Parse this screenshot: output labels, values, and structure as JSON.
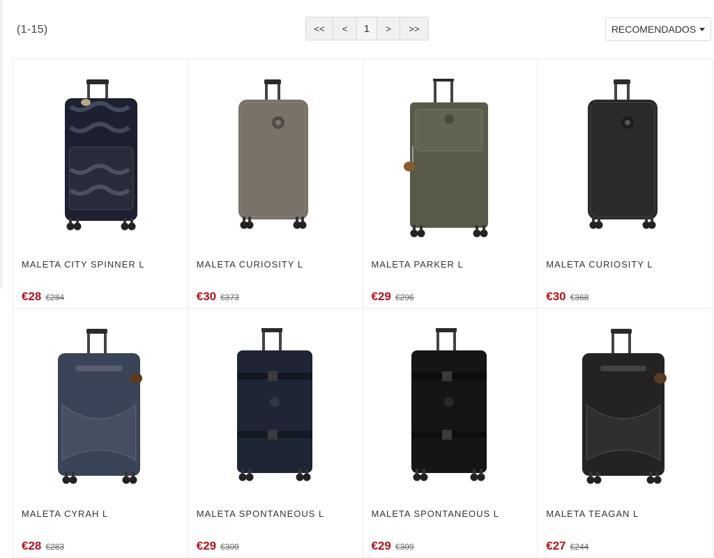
{
  "toolbar": {
    "range": "(1-15)",
    "pagination": {
      "first": "<<",
      "prev": "<",
      "page": "1",
      "next": ">",
      "last": ">>"
    },
    "sort": {
      "label": "RECOMENDADOS",
      "icon": "caret-down-icon"
    }
  },
  "products": [
    {
      "name": "MALETA CITY SPINNER L",
      "price": "€28",
      "old_price": "€284",
      "image": "suitcase-camo-soft",
      "color": "#1c2030"
    },
    {
      "name": "MALETA CURIOSITY L",
      "price": "€30",
      "old_price": "€373",
      "image": "suitcase-hard-shell",
      "color": "#7a7269"
    },
    {
      "name": "MALETA PARKER L",
      "price": "€29",
      "old_price": "€296",
      "image": "suitcase-soft-keychain",
      "color": "#5a5a4a"
    },
    {
      "name": "MALETA CURIOSITY L",
      "price": "€30",
      "old_price": "€368",
      "image": "suitcase-hard-shell",
      "color": "#2a2a2a"
    },
    {
      "name": "MALETA CYRAH L",
      "price": "€28",
      "old_price": "€283",
      "image": "duffel-trolley",
      "color": "#3a4458"
    },
    {
      "name": "MALETA SPONTANEOUS L",
      "price": "€29",
      "old_price": "€309",
      "image": "suitcase-strapped",
      "color": "#1e2535"
    },
    {
      "name": "MALETA SPONTANEOUS L",
      "price": "€29",
      "old_price": "€309",
      "image": "suitcase-strapped",
      "color": "#151515"
    },
    {
      "name": "MALETA TEAGAN L",
      "price": "€27",
      "old_price": "€244",
      "image": "duffel-trolley",
      "color": "#232323"
    }
  ]
}
